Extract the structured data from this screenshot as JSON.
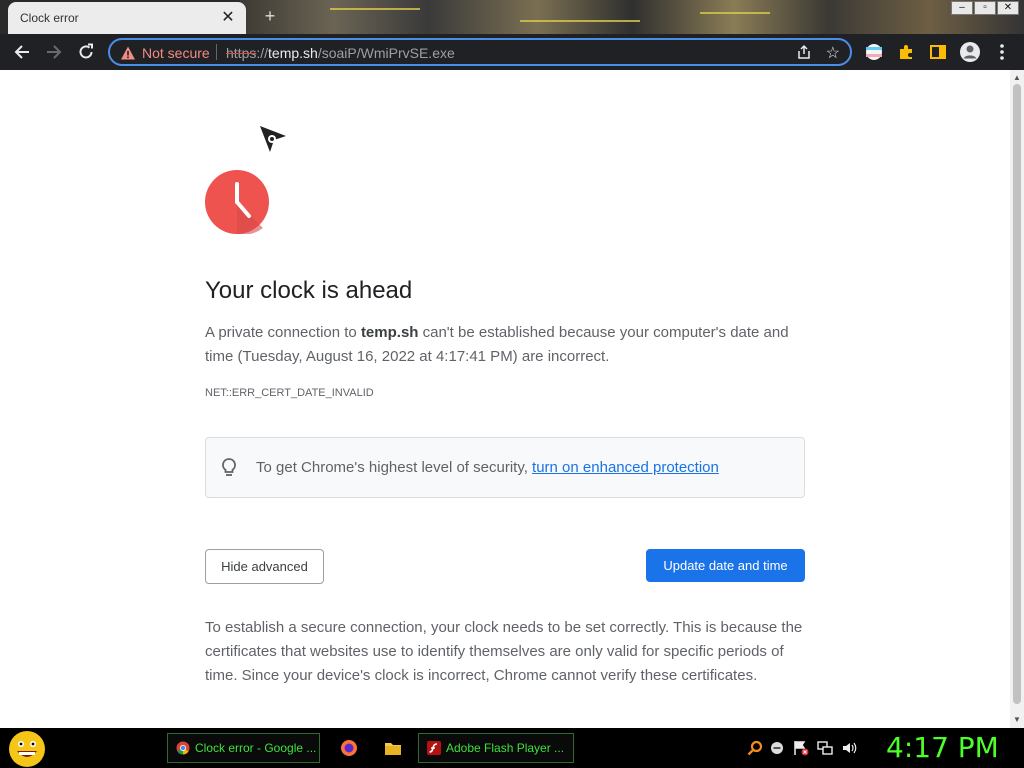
{
  "browser": {
    "tab_title": "Clock error",
    "tab_close": "✕",
    "new_tab": "+",
    "security_label": "Not secure",
    "url_scheme": "https",
    "url_sep": "://",
    "url_host": "temp.sh",
    "url_path": "/soaiP/WmiPrvSE.exe"
  },
  "page": {
    "heading": "Your clock is ahead",
    "explanation_prefix": "A private connection to ",
    "explanation_host": "temp.sh",
    "explanation_suffix": " can't be established because your computer's date and time (Tuesday, August 16, 2022 at 4:17:41 PM) are incorrect.",
    "error_code": "NET::ERR_CERT_DATE_INVALID",
    "tip_text": "To get Chrome's highest level of security, ",
    "tip_link": "turn on enhanced protection",
    "hide_advanced": "Hide advanced",
    "update_button": "Update date and time",
    "details": "To establish a secure connection, your clock needs to be set correctly. This is because the certificates that websites use to identify themselves are only valid for specific periods of time. Since your device's clock is incorrect, Chrome cannot verify these certificates."
  },
  "taskbar": {
    "task_chrome": "Clock error - Google ...",
    "task_flash": "Adobe Flash Player ...",
    "clock": "4:17 PM"
  },
  "colors": {
    "accent": "#1a73e8",
    "clock_icon": "#ee5350",
    "not_secure": "#f28b82",
    "taskbar_text": "#3ee03e"
  }
}
